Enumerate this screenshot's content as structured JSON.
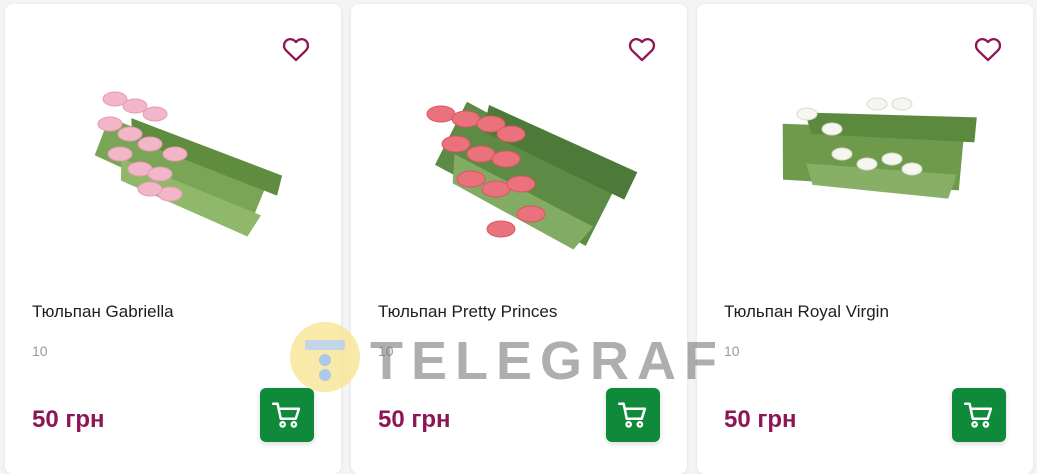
{
  "products": [
    {
      "title": "Тюльпан Gabriella",
      "quantity": "10",
      "price": "50 грн",
      "flower_color": "#f2b6c8"
    },
    {
      "title": "Тюльпан Pretty Princes",
      "quantity": "10",
      "price": "50 грн",
      "flower_color": "#e9727c"
    },
    {
      "title": "Тюльпан Royal Virgin",
      "quantity": "10",
      "price": "50 грн",
      "flower_color": "#f6f6f0"
    }
  ],
  "watermark": {
    "text": "TELEGRAF"
  },
  "colors": {
    "price": "#8e1656",
    "heart_icon": "#8e1656",
    "cart_button": "#0f8a3a",
    "leaves": "#6a9a4a"
  },
  "icons": {
    "favorite": "heart-outline-icon",
    "cart": "shopping-cart-icon"
  }
}
